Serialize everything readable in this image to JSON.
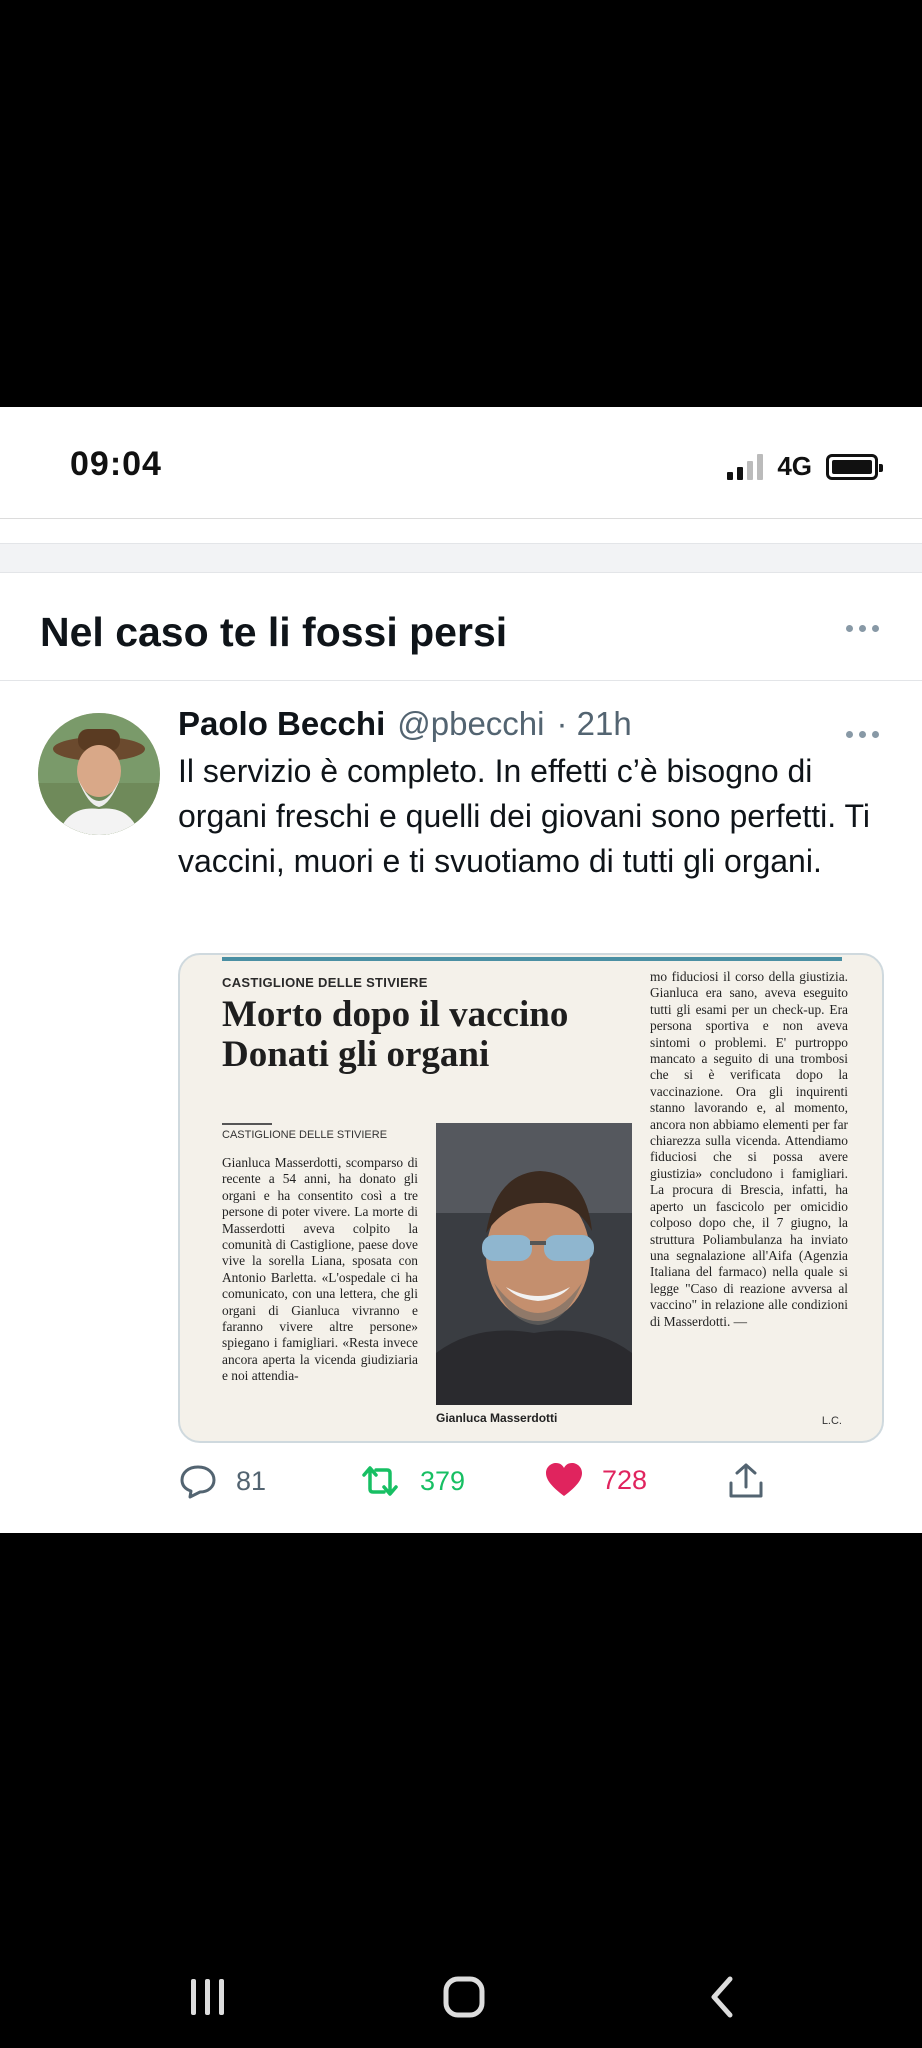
{
  "status_bar": {
    "time": "09:04",
    "network": "4G",
    "signal_level": 0.5,
    "battery_level": 1.0
  },
  "section": {
    "title": "Nel caso te li fossi persi",
    "more_icon": "more-horizontal-icon"
  },
  "tweet": {
    "author_name": "Paolo Becchi",
    "author_handle": "@pbecchi",
    "time": "· 21h",
    "text": "Il servizio è completo. In effetti c’è bisogno di organi freschi e quelli dei giovani sono perfetti. Ti vaccini, muori e ti svuotiamo di tutti gli organi.",
    "media": {
      "kicker": "CASTIGLIONE DELLE STIVIERE",
      "headline": "Morto dopo il vaccino Donati gli organi",
      "byline": "CASTIGLIONE DELLE STIVIERE",
      "column1": "Gianluca Masserdotti, scomparso di recente a 54 anni, ha donato gli organi e ha consentito così a tre persone di poter vivere. La morte di Masserdotti aveva colpito la comunità di Castiglione, paese dove vive la sorella Liana, sposata con Antonio Barletta. «L'ospedale ci ha comunicato, con una lettera, che gli organi di Gianluca vivranno e faranno vivere altre persone» spiegano i famigliari. «Resta invece ancora aperta la vicenda giudiziaria e noi attendia-",
      "column3": "mo fiduciosi il corso della giustizia. Gianluca era sano, aveva eseguito tutti gli esami per un check-up. Era persona sportiva e non aveva sintomi o problemi. E' purtroppo mancato a seguito di una trombosi che si è verificata dopo la vaccinazione. Ora gli inquirenti stanno lavorando e, al momento, ancora non abbiamo elementi per far chiarezza sulla vicenda. Attendiamo fiduciosi che si possa avere giustizia» concludono i famigliari. La procura di Brescia, infatti, ha aperto un fascicolo per omicidio colposo dopo che, il 7 giugno, la struttura Poliambulanza ha inviato una segnalazione all'Aifa (Agenzia Italiana del farmaco) nella quale si legge \"Caso di reazione avversa al vaccino\" in relazione alle condizioni di Masserdotti. —",
      "photo_caption": "Gianluca Masserdotti",
      "initials": "L.C."
    },
    "actions": {
      "replies": "81",
      "retweets": "379",
      "likes": "728"
    }
  },
  "colors": {
    "retweet": "#17bf63",
    "like": "#e0245e",
    "muted": "#536471",
    "text": "#0f1419"
  },
  "nav": {
    "recents_icon": "recents-icon",
    "home_icon": "home-icon",
    "back_icon": "back-icon"
  }
}
